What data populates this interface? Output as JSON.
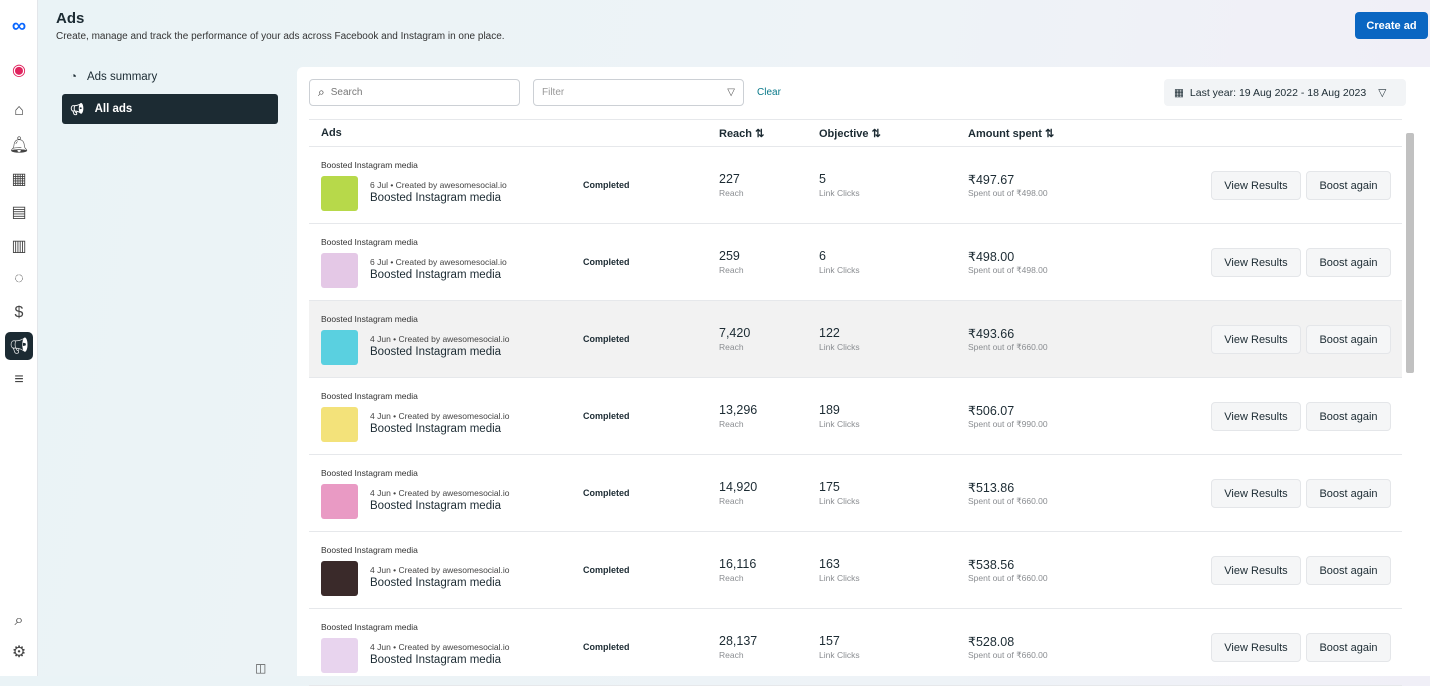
{
  "header": {
    "title": "Ads",
    "subtitle": "Create, manage and track the performance of your ads across Facebook and Instagram in one place.",
    "create_label": "Create ad"
  },
  "nav": [
    {
      "label": "Ads summary",
      "icon": "gauge-icon"
    },
    {
      "label": "All ads",
      "icon": "megaphone-icon",
      "active": true
    }
  ],
  "toolbar": {
    "search_placeholder": "Search",
    "filter_placeholder": "Filter",
    "clear_label": "Clear",
    "date_range": "Last year: 19 Aug 2022 - 18 Aug 2023"
  },
  "columns": {
    "ads": "Ads",
    "reach": "Reach ⇅",
    "objective": "Objective ⇅",
    "amount": "Amount spent ⇅"
  },
  "rows": [
    {
      "type": "Boosted Instagram media",
      "date": "6 Jul",
      "creator": "Created by awesomesocial.io",
      "name": "Boosted Instagram media",
      "status": "Completed",
      "reach": "227",
      "reach_label": "Reach",
      "objective": "5",
      "objective_label": "Link Clicks",
      "amount": "₹497.67",
      "budget": "Spent out of ₹498.00",
      "view": "View Results",
      "boost": "Boost again",
      "thumb": "#b7d94a"
    },
    {
      "type": "Boosted Instagram media",
      "date": "6 Jul",
      "creator": "Created by awesomesocial.io",
      "name": "Boosted Instagram media",
      "status": "Completed",
      "reach": "259",
      "reach_label": "Reach",
      "objective": "6",
      "objective_label": "Link Clicks",
      "amount": "₹498.00",
      "budget": "Spent out of ₹498.00",
      "view": "View Results",
      "boost": "Boost again",
      "thumb": "#e4c8e6"
    },
    {
      "type": "Boosted Instagram media",
      "date": "4 Jun",
      "creator": "Created by awesomesocial.io",
      "name": "Boosted Instagram media",
      "status": "Completed",
      "reach": "7,420",
      "reach_label": "Reach",
      "objective": "122",
      "objective_label": "Link Clicks",
      "amount": "₹493.66",
      "budget": "Spent out of ₹660.00",
      "view": "View Results",
      "boost": "Boost again",
      "thumb": "#5ad0e0"
    },
    {
      "type": "Boosted Instagram media",
      "date": "4 Jun",
      "creator": "Created by awesomesocial.io",
      "name": "Boosted Instagram media",
      "status": "Completed",
      "reach": "13,296",
      "reach_label": "Reach",
      "objective": "189",
      "objective_label": "Link Clicks",
      "amount": "₹506.07",
      "budget": "Spent out of ₹990.00",
      "view": "View Results",
      "boost": "Boost again",
      "thumb": "#f3e27a"
    },
    {
      "type": "Boosted Instagram media",
      "date": "4 Jun",
      "creator": "Created by awesomesocial.io",
      "name": "Boosted Instagram media",
      "status": "Completed",
      "reach": "14,920",
      "reach_label": "Reach",
      "objective": "175",
      "objective_label": "Link Clicks",
      "amount": "₹513.86",
      "budget": "Spent out of ₹660.00",
      "view": "View Results",
      "boost": "Boost again",
      "thumb": "#e99ac4"
    },
    {
      "type": "Boosted Instagram media",
      "date": "4 Jun",
      "creator": "Created by awesomesocial.io",
      "name": "Boosted Instagram media",
      "status": "Completed",
      "reach": "16,116",
      "reach_label": "Reach",
      "objective": "163",
      "objective_label": "Link Clicks",
      "amount": "₹538.56",
      "budget": "Spent out of ₹660.00",
      "view": "View Results",
      "boost": "Boost again",
      "thumb": "#3a2a2a"
    },
    {
      "type": "Boosted Instagram media",
      "date": "4 Jun",
      "creator": "Created by awesomesocial.io",
      "name": "Boosted Instagram media",
      "status": "Completed",
      "reach": "28,137",
      "reach_label": "Reach",
      "objective": "157",
      "objective_label": "Link Clicks",
      "amount": "₹528.08",
      "budget": "Spent out of ₹660.00",
      "view": "View Results",
      "boost": "Boost again",
      "thumb": "#e8d4ee"
    }
  ]
}
